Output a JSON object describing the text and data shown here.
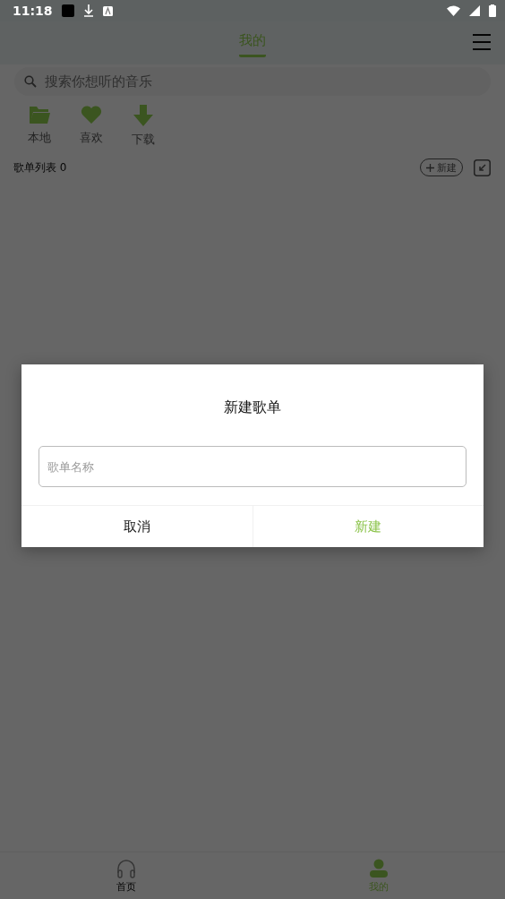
{
  "status_bar": {
    "time": "11:18"
  },
  "header": {
    "tabs": [
      {
        "label": "我的",
        "selected": true
      }
    ]
  },
  "search": {
    "placeholder": "搜索你想听的音乐"
  },
  "shortcuts": [
    {
      "kind": "folder",
      "label": "本地"
    },
    {
      "kind": "heart",
      "label": "喜欢"
    },
    {
      "kind": "download",
      "label": "下载"
    }
  ],
  "playlists": {
    "title": "歌单列表 0",
    "new_button": "新建"
  },
  "dialog": {
    "title": "新建歌单",
    "field": {
      "placeholder": "歌单名称"
    },
    "buttons": [
      {
        "label": "取消",
        "kind": "cancel"
      },
      {
        "label": "新建",
        "kind": "confirm"
      }
    ]
  },
  "bottom_nav": [
    {
      "kind": "headphones",
      "label": "首页",
      "selected": false
    },
    {
      "kind": "person",
      "label": "我的",
      "selected": true
    }
  ]
}
